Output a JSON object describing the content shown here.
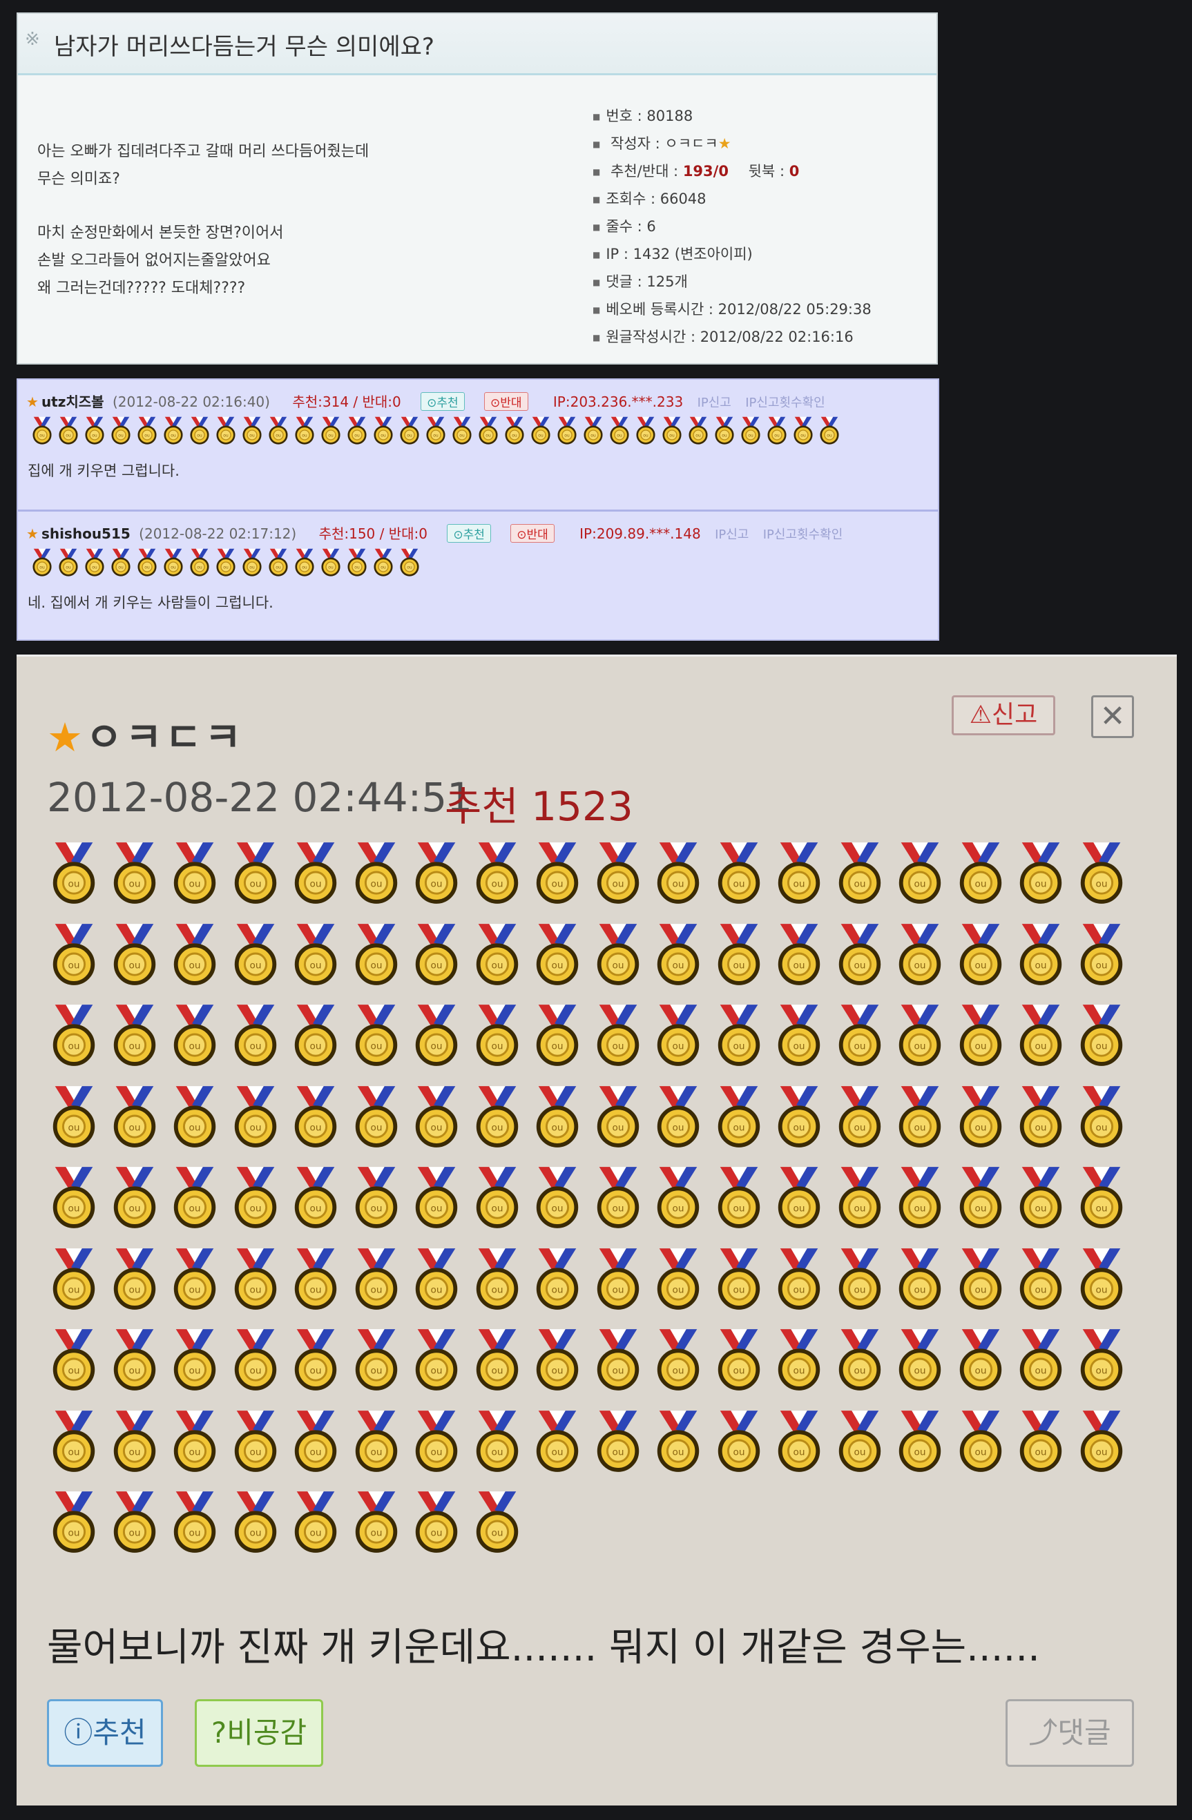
{
  "post": {
    "title": "남자가 머리쓰다듬는거 무슨 의미에요?",
    "body_paragraphs": [
      "아는 오빠가 집데려다주고 갈때 머리 쓰다듬어줬는데\n무슨 의미죠?",
      "마치 순정만화에서 본듯한 장면?이어서\n손발 오그라들어 없어지는줄알았어요\n왜 그러는건데????? 도대체????"
    ],
    "meta": {
      "number": "번호 : 80188",
      "author_label": "작성자 : ",
      "author_name": "ㅇㅋㄷㅋ",
      "recommend_label": "추천/반대 : ",
      "recommend_value": "193/0",
      "back_label": "뒷북 : ",
      "back_value": "0",
      "views": "조회수 : 66048",
      "lines": "줄수 : 6",
      "ip": "IP : 1432 (변조아이피)",
      "comments": "댓글 : 125개",
      "best_time": "베오베 등록시간 : 2012/08/22 05:29:38",
      "original_time": "원글작성시간 : 2012/08/22 02:16:16"
    }
  },
  "comments": [
    {
      "name": "utz치즈볼",
      "date": "(2012-08-22 02:16:40)",
      "rec": "추천:314 / 반대:0",
      "btn_good": "추천",
      "btn_bad": "반대",
      "ip": "IP:203.236.***.233",
      "report": "IP신고",
      "report_check": "IP신고횟수확인",
      "text": "집에 개 키우면 그럽니다."
    },
    {
      "name": "shishou515",
      "date": "(2012-08-22 02:17:12)",
      "rec": "추천:150 / 반대:0",
      "btn_good": "추천",
      "btn_bad": "반대",
      "ip": "IP:209.89.***.148",
      "report": "IP신고",
      "report_check": "IP신고횟수확인",
      "text": "네. 집에서 개 키우는 사람들이 그럽니다."
    }
  ],
  "big_comment": {
    "author": "ㅇㅋㄷㅋ",
    "report_label": "신고",
    "close_label": "✕",
    "datetime": "2012-08-22 02:44:51",
    "recommend": "추천 1523",
    "text": "물어보니까 진짜 개 키운데요....... 뭐지 이 개같은 경우는......",
    "btn_recommend": "추천",
    "btn_dislike": "비공감",
    "btn_reply": "댓글"
  },
  "medal_counts": {
    "comment1": 31,
    "comment2": 15,
    "big": 152
  },
  "colors": {
    "medal_gold": "#f0c535",
    "ribbon_red": "#d22a2a",
    "ribbon_blue": "#2c45b8"
  },
  "icons": {
    "medal": "medal-icon",
    "star": "star-icon",
    "report": "report-icon",
    "close": "close-icon",
    "reply": "reply-icon"
  }
}
